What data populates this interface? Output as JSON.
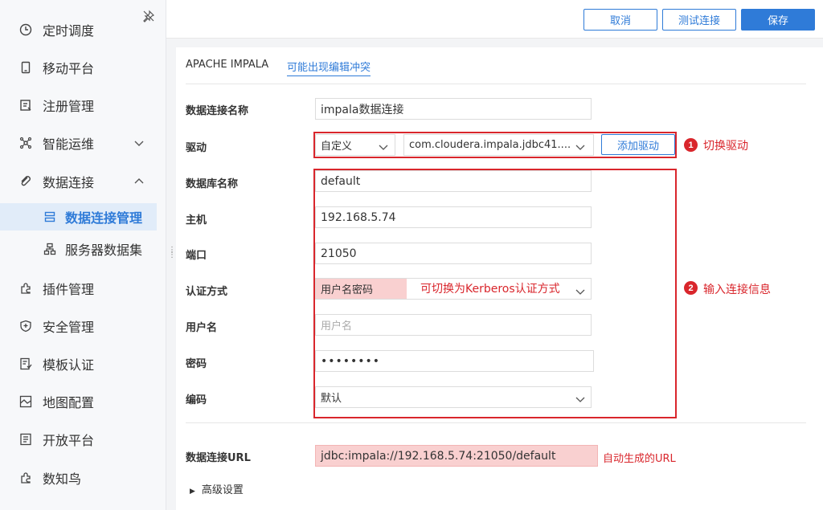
{
  "sidebar": {
    "items": [
      {
        "label": "定时调度",
        "icon": "clock-icon"
      },
      {
        "label": "移动平台",
        "icon": "mobile-icon"
      },
      {
        "label": "注册管理",
        "icon": "register-icon"
      },
      {
        "label": "智能运维",
        "icon": "ops-icon"
      },
      {
        "label": "数据连接",
        "icon": "link-icon"
      },
      {
        "label": "插件管理",
        "icon": "plugin-icon"
      },
      {
        "label": "安全管理",
        "icon": "shield-icon"
      },
      {
        "label": "模板认证",
        "icon": "template-icon"
      },
      {
        "label": "地图配置",
        "icon": "map-icon"
      },
      {
        "label": "开放平台",
        "icon": "open-platform-icon"
      },
      {
        "label": "数知鸟",
        "icon": "bird-icon"
      }
    ],
    "sub_items": [
      {
        "label": "数据连接管理",
        "icon": "database-icon"
      },
      {
        "label": "服务器数据集",
        "icon": "server-dataset-icon"
      }
    ]
  },
  "toolbar": {
    "cancel_label": "取消",
    "test_label": "测试连接",
    "save_label": "保存"
  },
  "header": {
    "db_type": "APACHE IMPALA",
    "conflict_link": "可能出现编辑冲突"
  },
  "form": {
    "name_label": "数据连接名称",
    "name_value": "impala数据连接",
    "driver_label": "驱动",
    "driver_mode": "自定义",
    "driver_class": "com.cloudera.impala.jdbc41....",
    "add_driver": "添加驱动",
    "dbname_label": "数据库名称",
    "dbname_value": "default",
    "host_label": "主机",
    "host_value": "192.168.5.74",
    "port_label": "端口",
    "port_value": "21050",
    "auth_label": "认证方式",
    "auth_value": "用户名密码",
    "user_label": "用户名",
    "user_placeholder": "用户名",
    "pwd_label": "密码",
    "pwd_value": "••••••••",
    "enc_label": "编码",
    "enc_value": "默认",
    "url_label": "数据连接URL",
    "url_value": "jdbc:impala://192.168.5.74:21050/default",
    "advanced": "高级设置"
  },
  "annotations": {
    "step1_num": "1",
    "step1_text": "切换驱动",
    "step2_num": "2",
    "step2_text": "输入连接信息",
    "auth_hint": "可切换为Kerberos认证方式",
    "url_hint": "自动生成的URL"
  },
  "colors": {
    "accent": "#2f7bd8",
    "annotation_red": "#d9262c",
    "highlight_pink": "#f9d0d0"
  }
}
